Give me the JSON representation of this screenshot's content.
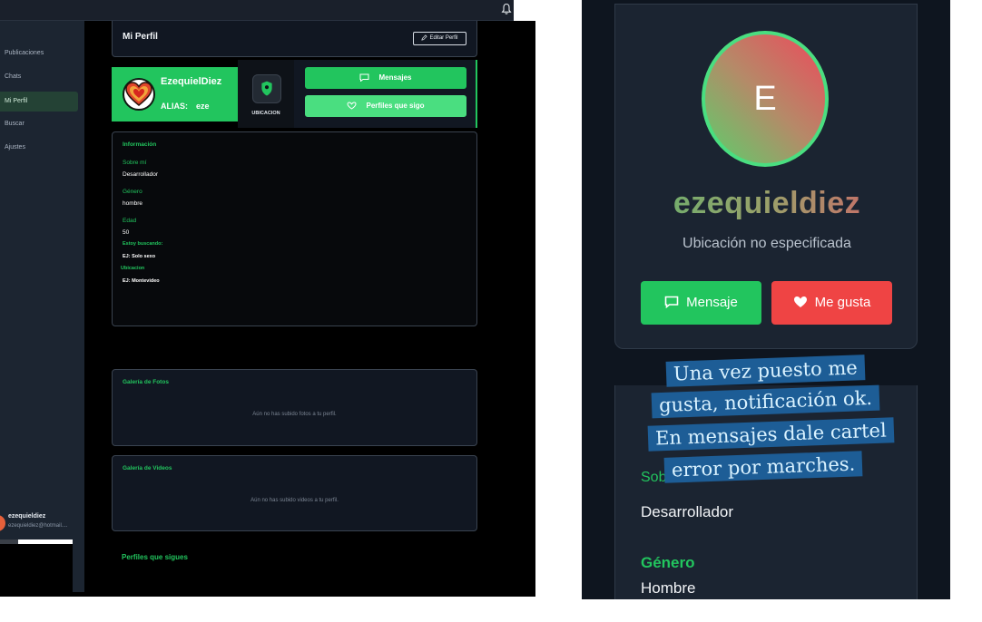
{
  "left": {
    "sidebar": {
      "items": [
        {
          "label": "Publicaciones"
        },
        {
          "label": "Chats"
        },
        {
          "label": "Mi Perfil",
          "active": true
        },
        {
          "label": "Buscar"
        },
        {
          "label": "Ajustes"
        }
      ],
      "user": {
        "name": "ezequieldiez",
        "email": "ezequieldiez@hotmail...."
      }
    },
    "header": {
      "title": "Mi Perfil",
      "edit_label": "Editar Perfil"
    },
    "profile_card": {
      "name": "EzequielDiez",
      "alias_label": "ALIAS:",
      "alias_value": "eze"
    },
    "location": {
      "label": "UBICACION"
    },
    "actions": {
      "messages": "Mensajes",
      "following": "Perfiles que sigo"
    },
    "info": {
      "title": "Información",
      "fields": [
        {
          "label": "Sobre mí",
          "value": "Desarrollador"
        },
        {
          "label": "Género",
          "value": "hombre"
        },
        {
          "label": "Edad",
          "value": "50"
        },
        {
          "label": "Estoy buscando:",
          "value": "EJ: Solo sexo"
        },
        {
          "label": "Ubicacion",
          "value": "EJ: Montevideo"
        }
      ]
    },
    "photo_gallery": {
      "title": "Galería de Fotos",
      "empty": "Aún no has subido fotos a tu perfil."
    },
    "video_gallery": {
      "title": "Galería de Videos",
      "empty": "Aún no has subido videos a tu perfil."
    },
    "following_title": "Perfiles que sigues"
  },
  "right": {
    "avatar_letter": "E",
    "name": "ezequieldiez",
    "location": "Ubicación no especificada",
    "message_button": "Mensaje",
    "like_button": "Me gusta",
    "info": {
      "partial_label": "Sob",
      "sobre_value": "Desarrollador",
      "genero_label": "Género",
      "genero_value": "Hombre"
    },
    "note_lines": [
      "Una vez puesto me",
      "gusta, notificación ok.",
      "En mensajes dale cartel",
      "error por marches."
    ]
  },
  "colors": {
    "accent_green": "#22c55e",
    "like_red": "#ef4444",
    "note_blue": "#1d5d96"
  }
}
